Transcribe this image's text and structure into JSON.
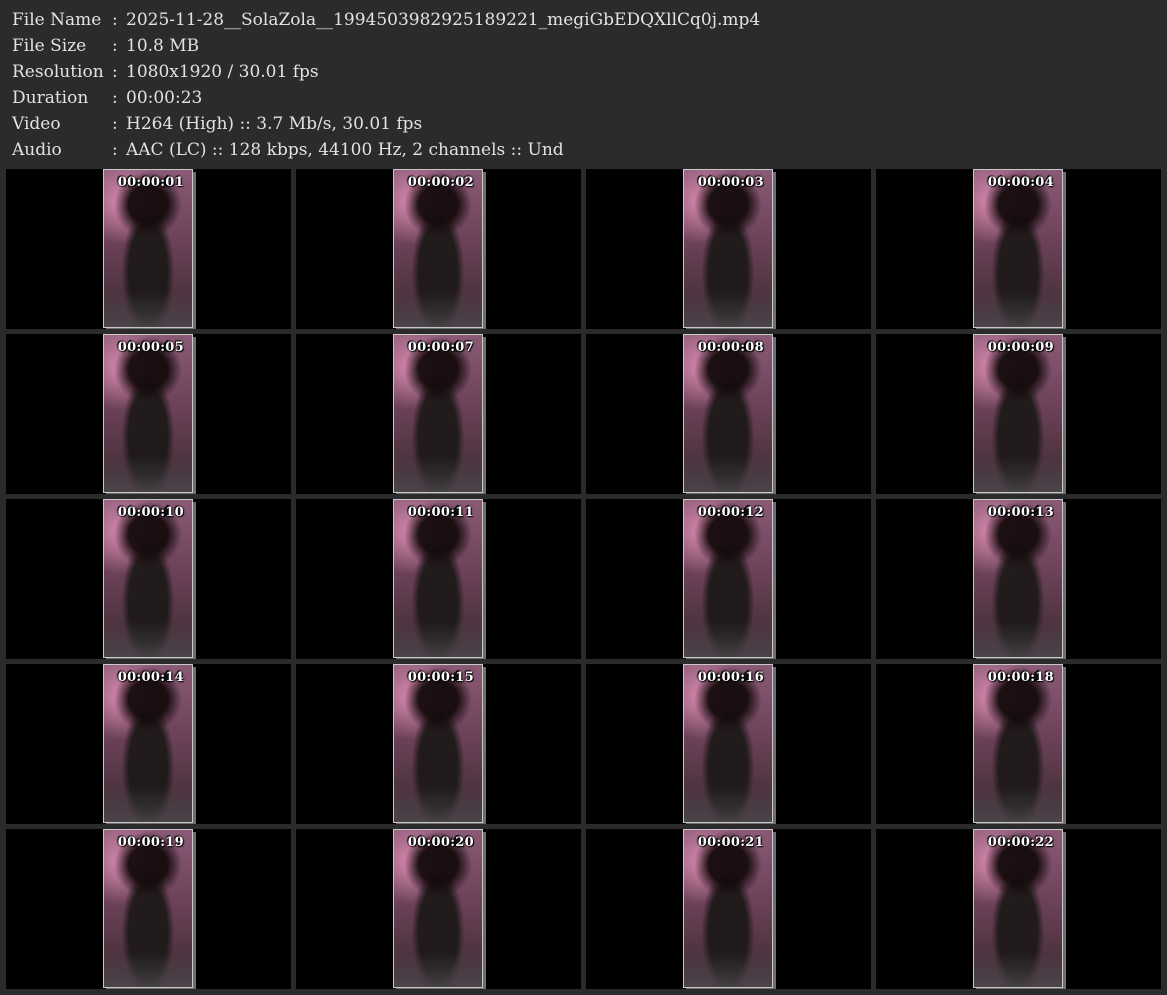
{
  "info": [
    {
      "label": "File Name",
      "value": "2025-11-28__SolaZola__1994503982925189221_megiGbEDQXllCq0j.mp4"
    },
    {
      "label": "File Size",
      "value": "10.8 MB"
    },
    {
      "label": "Resolution",
      "value": "1080x1920 / 30.01 fps"
    },
    {
      "label": "Duration",
      "value": "00:00:23"
    },
    {
      "label": "Video",
      "value": "H264 (High) :: 3.7 Mb/s, 30.01 fps"
    },
    {
      "label": "Audio",
      "value": "AAC (LC) :: 128 kbps, 44100 Hz, 2 channels :: Und"
    }
  ],
  "separator": ":",
  "thumbnails": [
    {
      "time": "00:00:01",
      "ears": true
    },
    {
      "time": "00:00:02",
      "ears": false
    },
    {
      "time": "00:00:03",
      "ears": true
    },
    {
      "time": "00:00:04",
      "ears": true
    },
    {
      "time": "00:00:05",
      "ears": true
    },
    {
      "time": "00:00:07",
      "ears": true
    },
    {
      "time": "00:00:08",
      "ears": true
    },
    {
      "time": "00:00:09",
      "ears": true
    },
    {
      "time": "00:00:10",
      "ears": true
    },
    {
      "time": "00:00:11",
      "ears": true
    },
    {
      "time": "00:00:12",
      "ears": true
    },
    {
      "time": "00:00:13",
      "ears": true
    },
    {
      "time": "00:00:14",
      "ears": true
    },
    {
      "time": "00:00:15",
      "ears": true
    },
    {
      "time": "00:00:16",
      "ears": true
    },
    {
      "time": "00:00:18",
      "ears": true
    },
    {
      "time": "00:00:19",
      "ears": false
    },
    {
      "time": "00:00:20",
      "ears": true
    },
    {
      "time": "00:00:21",
      "ears": false
    },
    {
      "time": "00:00:22",
      "ears": false
    }
  ],
  "colors": {
    "background": "#2b2b2b",
    "text": "#e2e2e2",
    "cell": "#000000",
    "frame_border": "#c8c8c8",
    "timestamp": "#ffffff"
  }
}
